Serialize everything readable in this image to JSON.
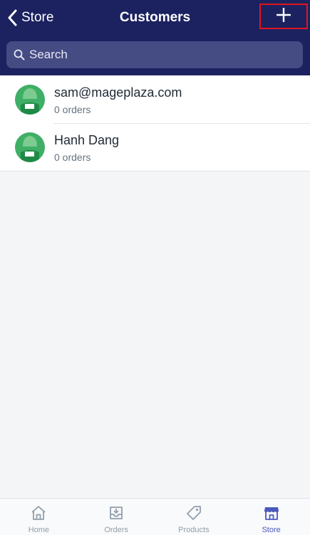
{
  "header": {
    "back_label": "Store",
    "title": "Customers",
    "add_icon": "plus-icon"
  },
  "search": {
    "placeholder": "Search",
    "icon": "search-icon"
  },
  "customers": [
    {
      "name": "sam@mageplaza.com",
      "orders": "0 orders"
    },
    {
      "name": "Hanh Dang",
      "orders": "0 orders"
    }
  ],
  "tabs": [
    {
      "label": "Home",
      "icon": "home-icon",
      "active": false
    },
    {
      "label": "Orders",
      "icon": "orders-icon",
      "active": false
    },
    {
      "label": "Products",
      "icon": "tag-icon",
      "active": false
    },
    {
      "label": "Store",
      "icon": "store-icon",
      "active": true
    }
  ],
  "colors": {
    "header_bg": "#1c2260",
    "search_bg": "#454b83",
    "highlight_border": "#e0141e",
    "avatar_green": "#3faf66",
    "tab_active": "#4959bd",
    "tab_inactive": "#919eab"
  }
}
